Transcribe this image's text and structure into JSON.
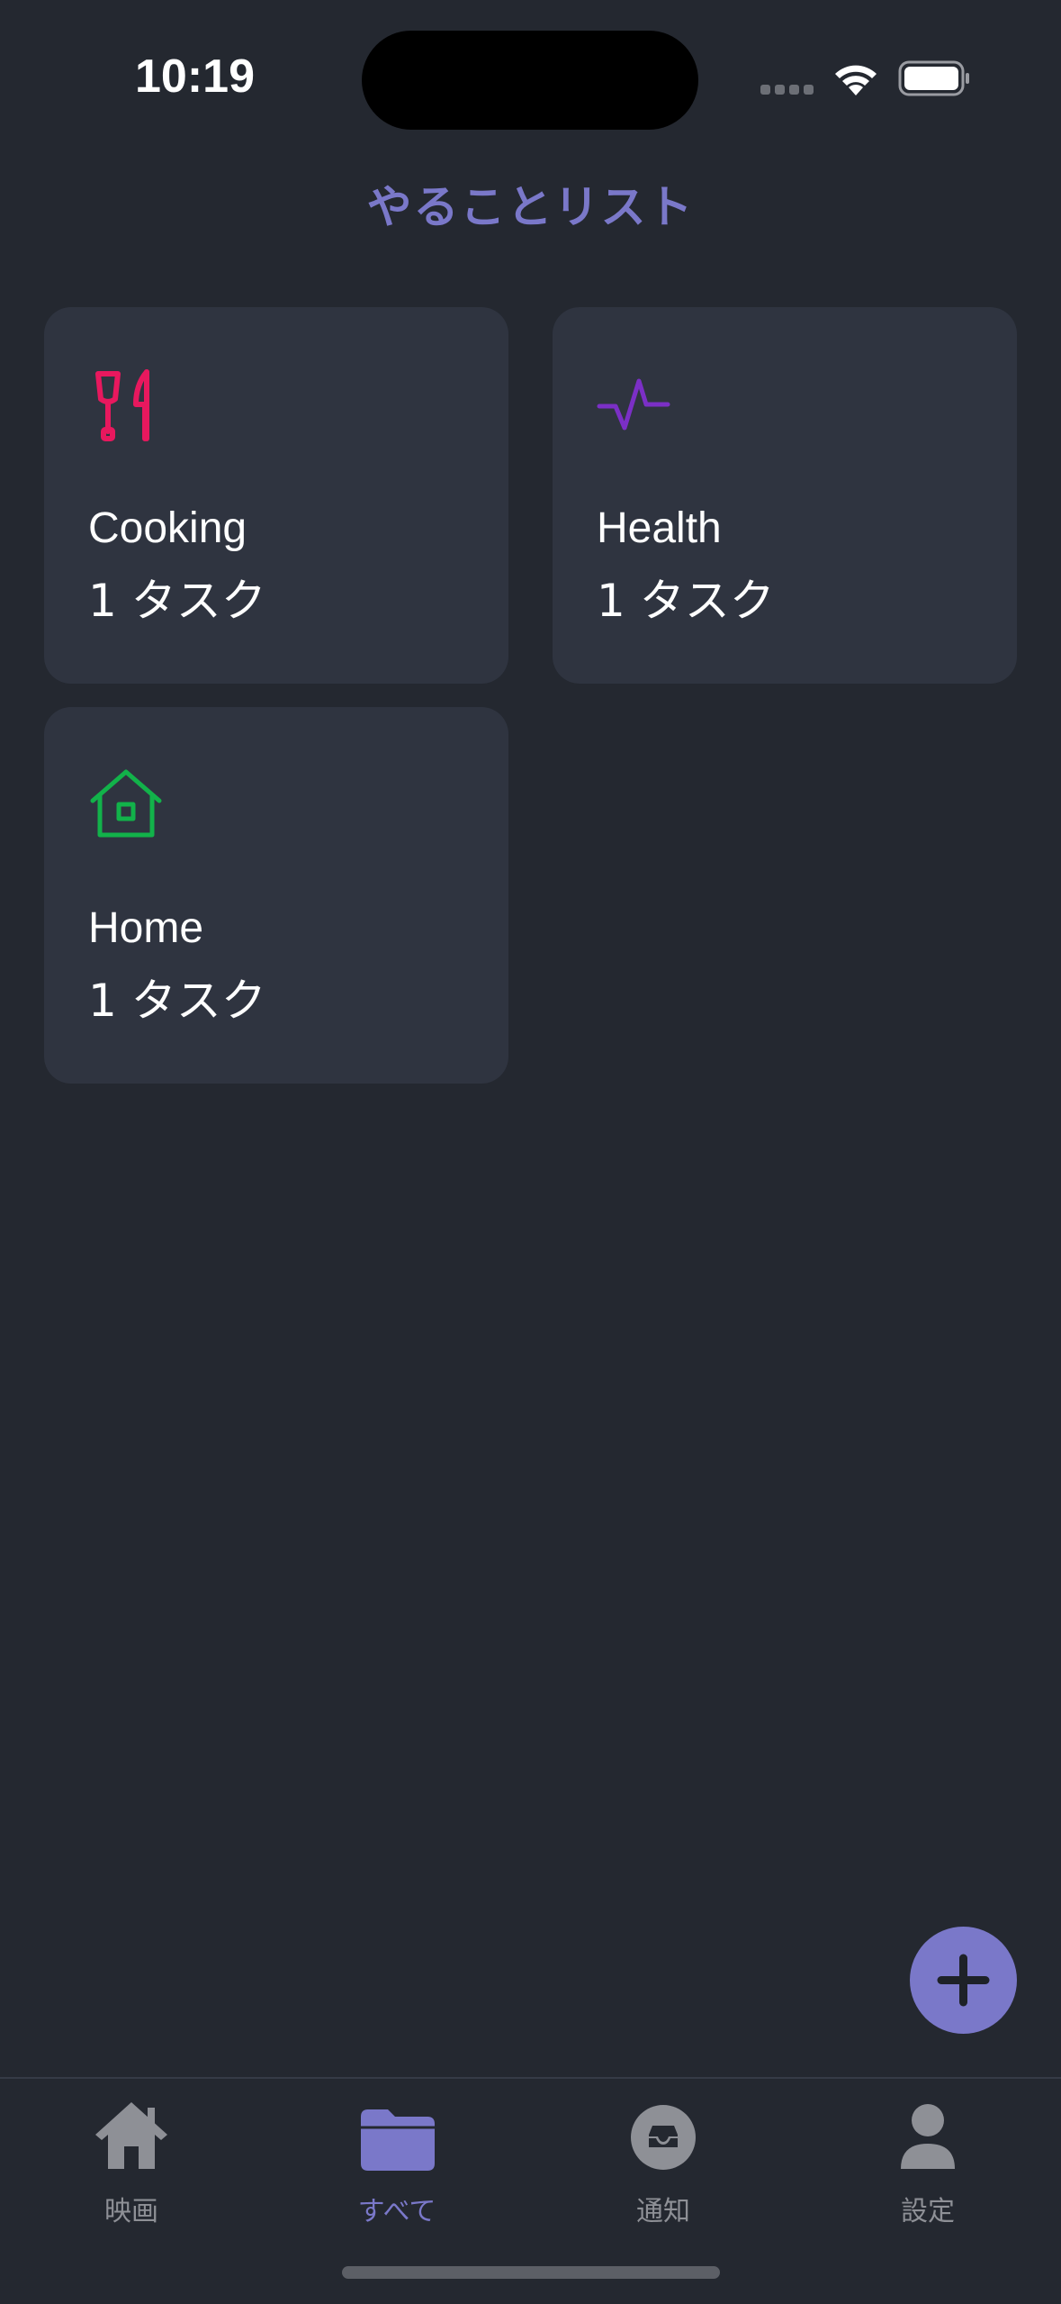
{
  "status_bar": {
    "time": "10:19",
    "icons": [
      "signal-icon",
      "wifi-icon",
      "battery-icon"
    ]
  },
  "header": {
    "title": "やることリスト"
  },
  "categories": [
    {
      "name": "Cooking",
      "count_label": "1 タスク",
      "icon": "utensils-icon",
      "color": "#e8185e"
    },
    {
      "name": "Health",
      "count_label": "1 タスク",
      "icon": "pulse-icon",
      "color": "#7b2fc6"
    },
    {
      "name": "Home",
      "count_label": "1 タスク",
      "icon": "house-icon",
      "color": "#12b24a"
    }
  ],
  "fab": {
    "icon": "plus-icon"
  },
  "tab_bar": {
    "tabs": [
      {
        "label": "映画",
        "icon": "home-icon",
        "active": false
      },
      {
        "label": "すべて",
        "icon": "folder-icon",
        "active": true
      },
      {
        "label": "通知",
        "icon": "inbox-icon",
        "active": false
      },
      {
        "label": "設定",
        "icon": "person-icon",
        "active": false
      }
    ]
  },
  "colors": {
    "background": "#242830",
    "card": "#2f3440",
    "accent": "#7a78c9",
    "inactive": "#8e9096"
  }
}
